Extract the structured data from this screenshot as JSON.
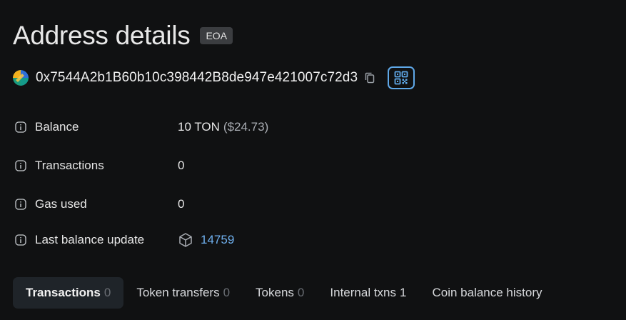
{
  "header": {
    "title": "Address details",
    "badge": "EOA"
  },
  "address": {
    "value": "0x7544A2b1B60b10c398442B8de947e421007c72d3",
    "avatar_icon": "identicon-icon",
    "copy_icon": "copy-icon",
    "qr_icon": "qr-code-icon"
  },
  "details": {
    "balance_label": "Balance",
    "balance_value": "10 TON",
    "balance_usd": "($24.73)",
    "transactions_label": "Transactions",
    "transactions_value": "0",
    "gas_label": "Gas used",
    "gas_value": "0",
    "last_update_label": "Last balance update",
    "last_update_block": "14759"
  },
  "tabs": [
    {
      "label": "Transactions",
      "count": "0",
      "active": true
    },
    {
      "label": "Token transfers",
      "count": "0",
      "active": false
    },
    {
      "label": "Tokens",
      "count": "0",
      "active": false
    },
    {
      "label": "Internal txns",
      "count": "1",
      "active": false
    },
    {
      "label": "Coin balance history",
      "count": "",
      "active": false
    }
  ],
  "colors": {
    "background": "#101112",
    "accent": "#5fa8e8",
    "link": "#6fb0ee",
    "badge_bg": "#3b3d40",
    "active_tab_bg": "#1f2429"
  }
}
